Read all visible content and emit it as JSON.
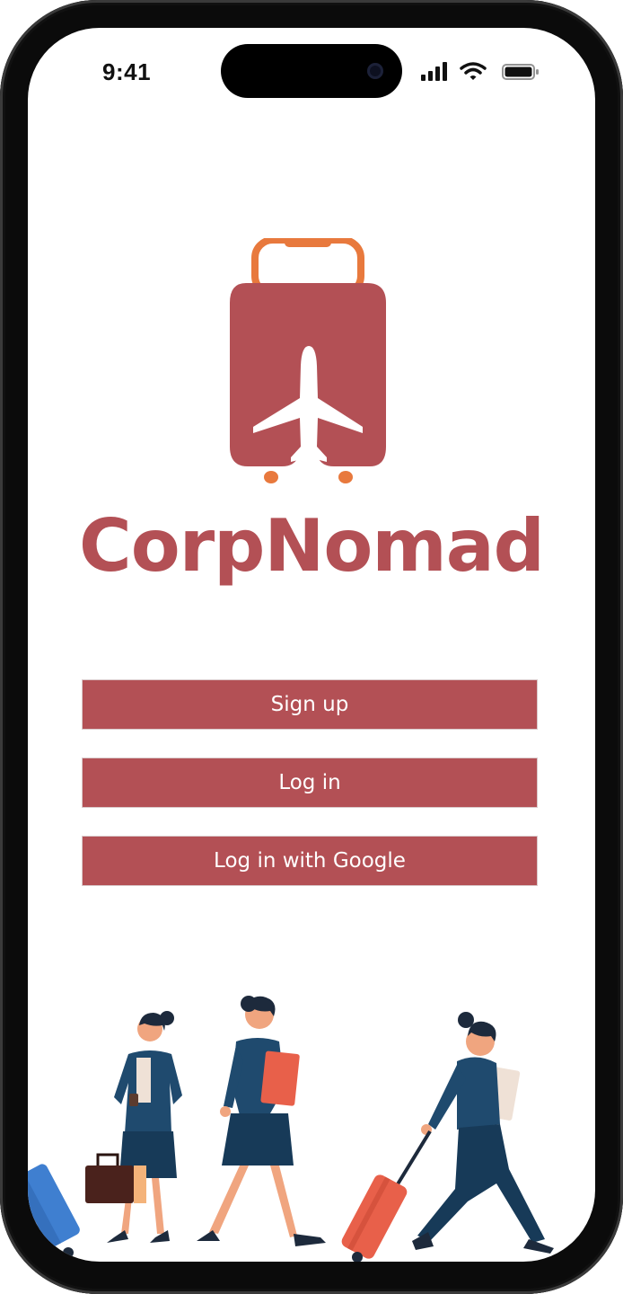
{
  "status_bar": {
    "time": "9:41"
  },
  "brand": {
    "name": "CorpNomad"
  },
  "auth": {
    "signup_label": "Sign up",
    "login_label": "Log in",
    "google_label": "Log in with Google"
  },
  "colors": {
    "primary": "#b35055",
    "accent": "#e8793d",
    "navy": "#1f4a6e"
  },
  "icons": {
    "logo": "suitcase-airplane-icon",
    "signal": "cellular-signal-icon",
    "wifi": "wifi-icon",
    "battery": "battery-icon"
  }
}
